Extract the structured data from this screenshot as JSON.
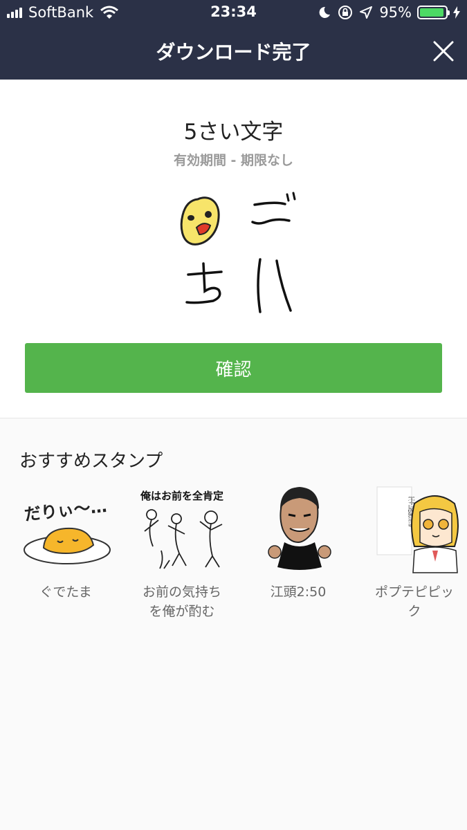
{
  "status_bar": {
    "carrier": "SoftBank",
    "time": "23:34",
    "battery": "95%",
    "battery_level": 0.95,
    "icons": [
      "signal-icon",
      "wifi-icon",
      "moon-icon",
      "orientation-lock-icon",
      "location-icon",
      "battery-icon",
      "charging-icon"
    ]
  },
  "header": {
    "title": "ダウンロード完了",
    "close_icon": "close-icon"
  },
  "sticker": {
    "title": "5さい文字",
    "validity": "有効期間 - 期限なし",
    "preview_text": "ごちハ"
  },
  "confirm_label": "確認",
  "recommended": {
    "heading": "おすすめスタンプ",
    "items": [
      {
        "name": "ぐでたま",
        "thumb_text": "だりぃ〜…"
      },
      {
        "name": "お前の気持ち\nを俺が酌む",
        "thumb_text": "俺はお前を全肯定"
      },
      {
        "name": "江頭2:50"
      },
      {
        "name": "ポプテピピッ\nク",
        "thumb_text": "あーそーゆーことね完全に理解した わかってない"
      }
    ]
  },
  "colors": {
    "header_bg": "#2b3147",
    "confirm_bg": "#54b44c",
    "battery_fill": "#4cd964"
  }
}
